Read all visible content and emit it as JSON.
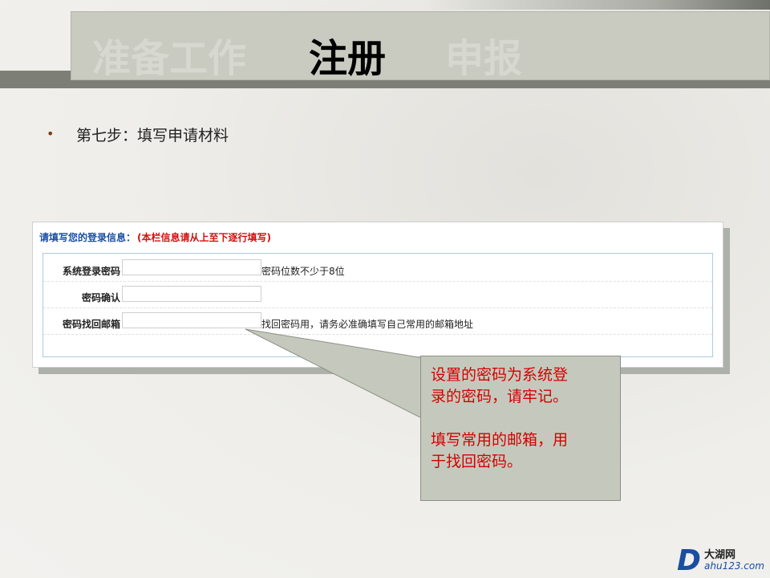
{
  "header": {
    "tabs": [
      {
        "label": "准备工作",
        "active": false
      },
      {
        "label": "注册",
        "active": true
      },
      {
        "label": "申报",
        "active": false
      }
    ]
  },
  "step": {
    "bullet": "•",
    "text": "第七步：填写申请材料"
  },
  "form": {
    "title": "请填写您的登录信息：",
    "note": "(本栏信息请从上至下逐行填写)",
    "rows": [
      {
        "label": "系统登录密码",
        "value": "",
        "hint": "密码位数不少于8位"
      },
      {
        "label": "密码确认",
        "value": "",
        "hint": ""
      },
      {
        "label": "密码找回邮箱",
        "value": "",
        "hint": "找回密码用，请务必准确填写自己常用的邮箱地址"
      }
    ]
  },
  "callout": {
    "line1": "设置的密码为系统登",
    "line2": "录的密码，请牢记。",
    "line3": "填写常用的邮箱，用",
    "line4": "于找回密码。"
  },
  "logo": {
    "letter": "D",
    "name": "大湖网",
    "url": "ahu123.com"
  },
  "colors": {
    "accent_blue": "#1b4fa3",
    "note_red": "#d21010",
    "callout_bg": "#c5c9bd"
  }
}
